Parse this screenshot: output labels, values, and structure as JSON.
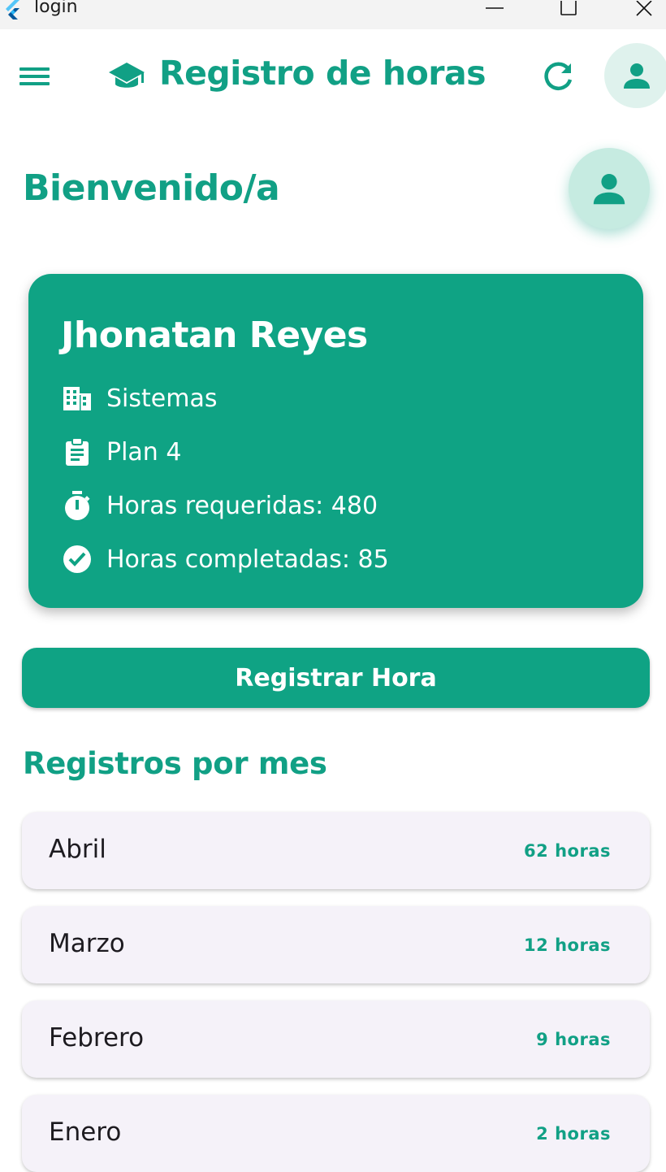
{
  "window": {
    "title": "login"
  },
  "appbar": {
    "title": "Registro de horas"
  },
  "welcome": {
    "heading": "Bienvenido/a"
  },
  "profile": {
    "name": "Jhonatan Reyes",
    "department": "Sistemas",
    "plan": "Plan 4",
    "required_hours": "Horas requeridas: 480",
    "completed_hours": "Horas completadas: 85"
  },
  "actions": {
    "register_label": "Registrar Hora"
  },
  "records": {
    "title": "Registros por mes",
    "items": [
      {
        "month": "Abril",
        "hours": "62 horas"
      },
      {
        "month": "Marzo",
        "hours": "12 horas"
      },
      {
        "month": "Febrero",
        "hours": "9 horas"
      },
      {
        "month": "Enero",
        "hours": "2 horas"
      }
    ]
  },
  "colors": {
    "primary": "#0fa384",
    "primary_text": "#11a085",
    "card_item_bg": "#f5f2f9",
    "avatar_bg": "#dff2ed"
  },
  "icons": {
    "menu": "menu-icon",
    "school": "school-icon",
    "refresh": "refresh-icon",
    "person": "person-icon",
    "building": "building-icon",
    "clipboard": "clipboard-icon",
    "timer": "timer-icon",
    "check": "check-circle-icon"
  }
}
